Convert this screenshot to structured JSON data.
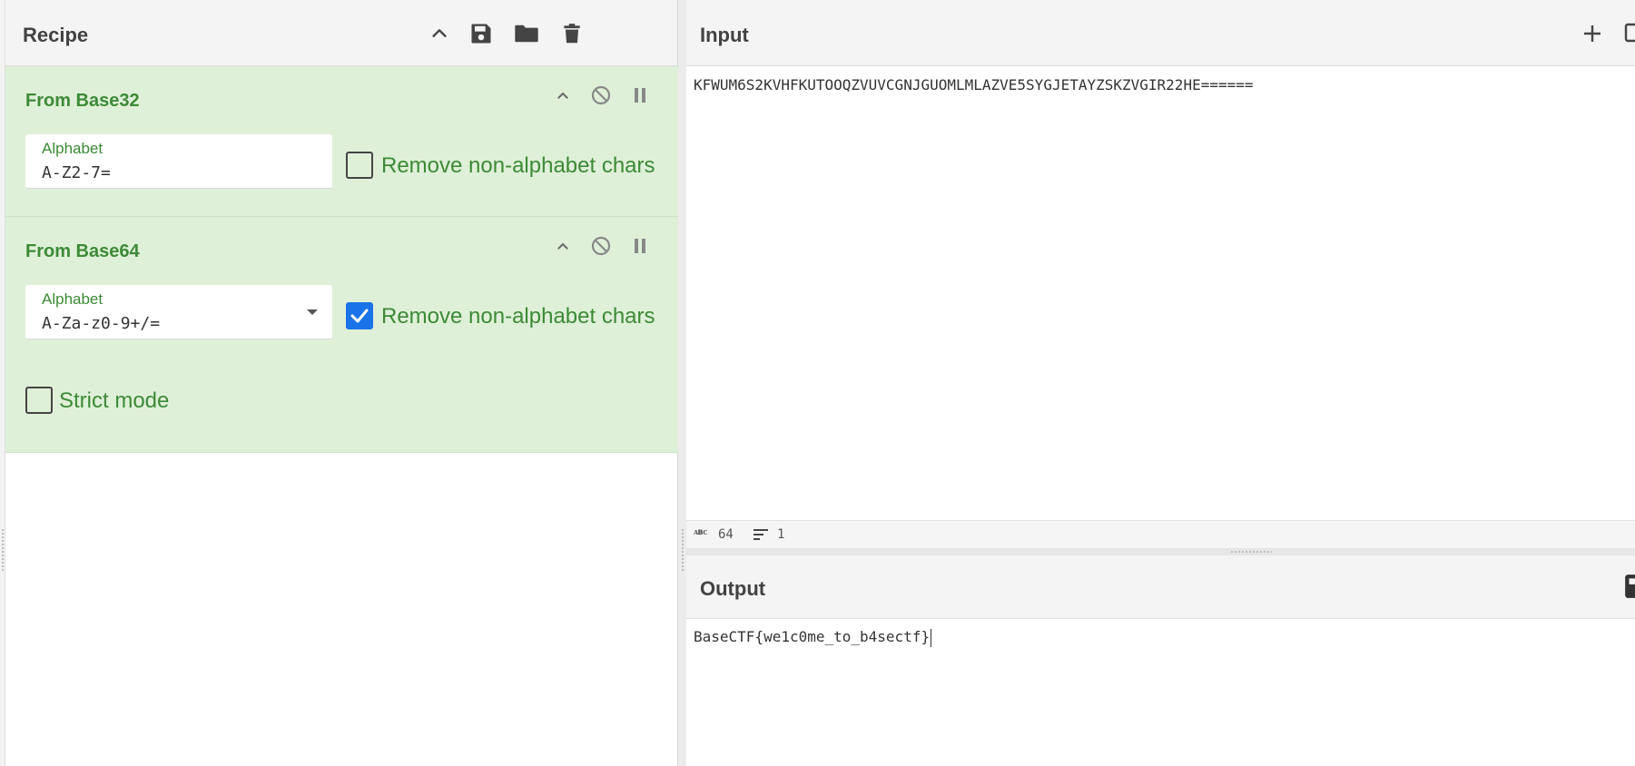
{
  "recipe": {
    "title": "Recipe",
    "operations": [
      {
        "name": "From Base32",
        "alphabet_label": "Alphabet",
        "alphabet_value": "A-Z2-7=",
        "remove_non_alphabet_label": "Remove non-alphabet chars",
        "remove_non_alphabet_checked": false
      },
      {
        "name": "From Base64",
        "alphabet_label": "Alphabet",
        "alphabet_value": "A-Za-z0-9+/=",
        "remove_non_alphabet_label": "Remove non-alphabet chars",
        "remove_non_alphabet_checked": true,
        "strict_mode_label": "Strict mode",
        "strict_mode_checked": false
      }
    ]
  },
  "input": {
    "title": "Input",
    "text": "KFWUM6S2KVHFKUTOOQZVUVCGNJGUOMLMLAZVE5SYGJETAYZSKZVGIR22HE======",
    "stats": {
      "length": "64",
      "lines": "1"
    }
  },
  "output": {
    "title": "Output",
    "text": "BaseCTF{we1c0me_to_b4sectf}"
  },
  "colors": {
    "accent_green": "#3c8a36",
    "operation_bg": "#dff0d8",
    "checkbox_blue": "#1a73e8"
  }
}
